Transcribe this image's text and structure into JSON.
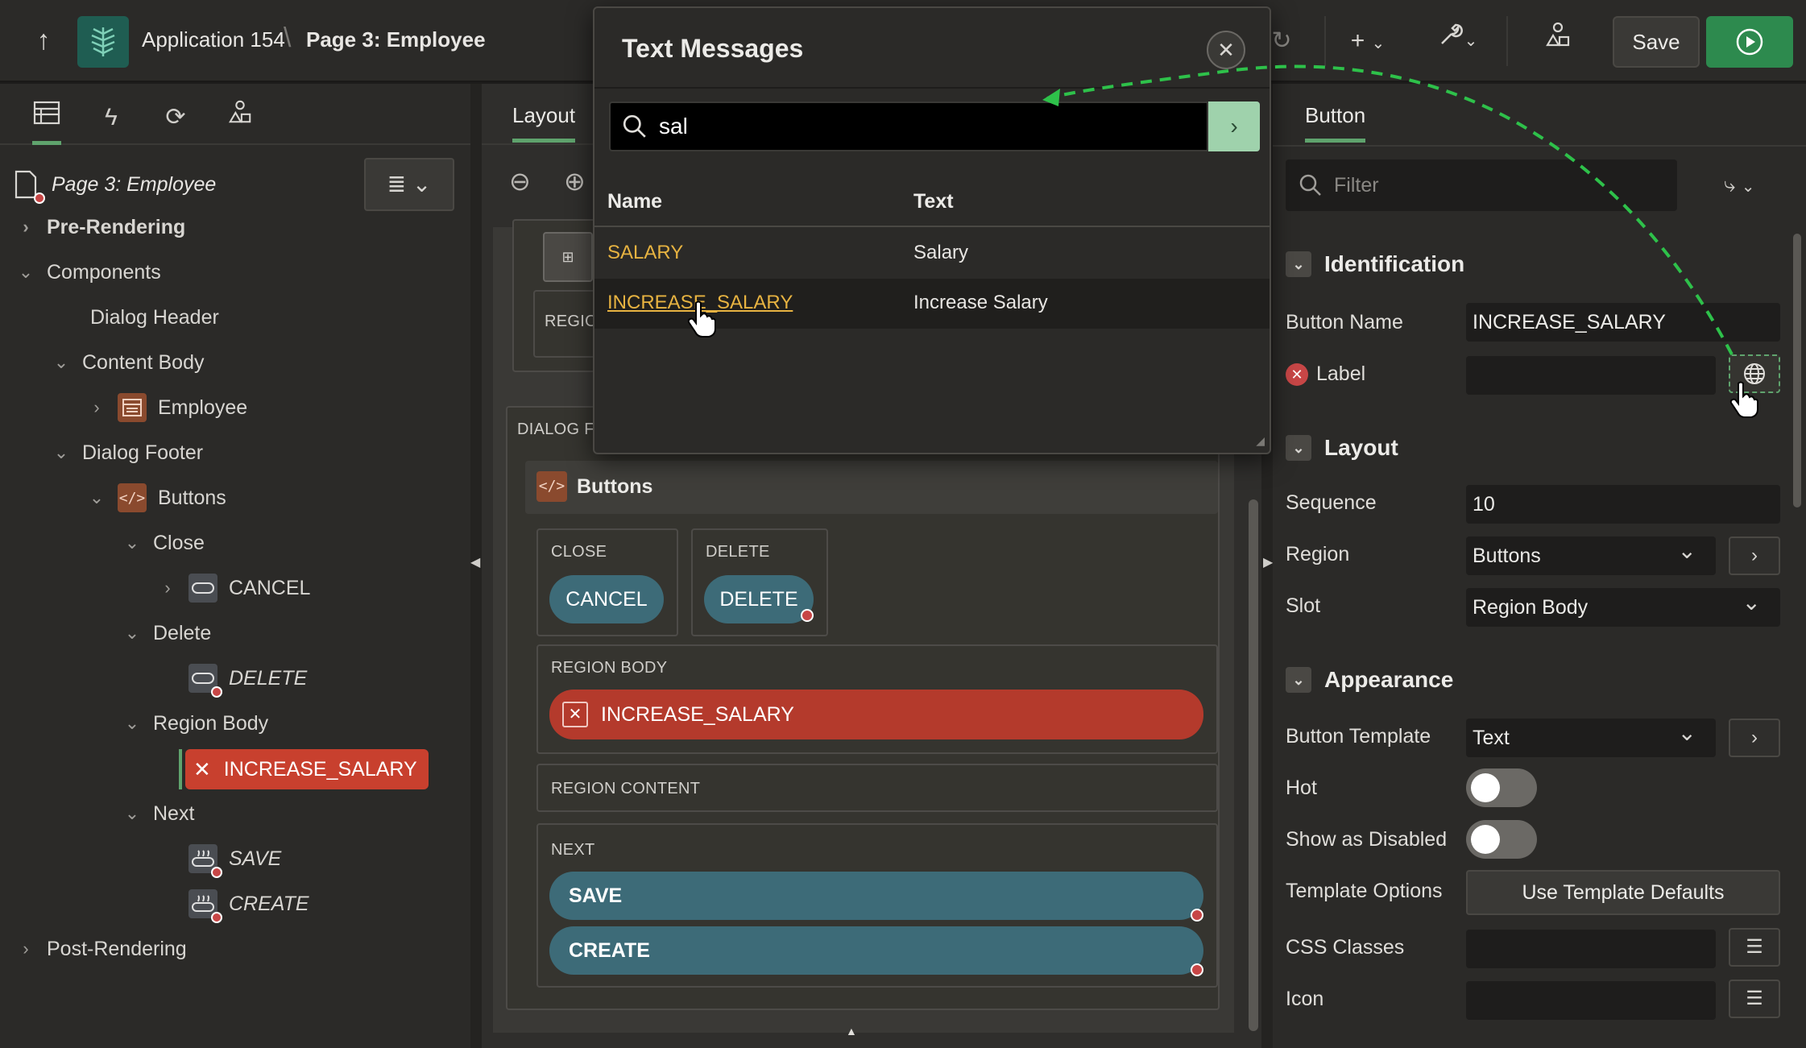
{
  "header": {
    "app_name": "Application 154",
    "separator": "\\",
    "page_name": "Page 3: Employee",
    "save_label": "Save"
  },
  "left_panel": {
    "page_title": "Page 3: Employee",
    "tree": {
      "pre_rendering": "Pre-Rendering",
      "components": "Components",
      "dialog_header": "Dialog Header",
      "content_body": "Content Body",
      "employee": "Employee",
      "dialog_footer": "Dialog Footer",
      "buttons": "Buttons",
      "close": "Close",
      "cancel": "CANCEL",
      "delete_slot": "Delete",
      "delete_btn": "DELETE",
      "region_body": "Region Body",
      "increase_salary": "INCREASE_SALARY",
      "next": "Next",
      "save": "SAVE",
      "create": "CREATE",
      "post_rendering": "Post-Rendering"
    }
  },
  "center": {
    "tab": "Layout",
    "region_label": "REGION",
    "dialog_footer_label": "DIALOG FO",
    "buttons_region": "Buttons",
    "close_label": "CLOSE",
    "delete_label": "DELETE",
    "cancel_btn": "CANCEL",
    "delete_btn": "DELETE",
    "region_body_label": "REGION BODY",
    "increase_salary": "INCREASE_SALARY",
    "region_content_label": "REGION CONTENT",
    "next_label": "NEXT",
    "save_btn": "SAVE",
    "create_btn": "CREATE"
  },
  "dialog": {
    "title": "Text Messages",
    "search_value": "sal",
    "col_name": "Name",
    "col_text": "Text",
    "rows": [
      {
        "name": "SALARY",
        "text": "Salary"
      },
      {
        "name": "INCREASE_SALARY",
        "text": "Increase Salary"
      }
    ]
  },
  "right_panel": {
    "tab": "Button",
    "filter_placeholder": "Filter",
    "identification": "Identification",
    "button_name_label": "Button Name",
    "button_name_value": "INCREASE_SALARY",
    "label_label": "Label",
    "label_value": "",
    "layout": "Layout",
    "sequence_label": "Sequence",
    "sequence_value": "10",
    "region_label": "Region",
    "region_value": "Buttons",
    "slot_label": "Slot",
    "slot_value": "Region Body",
    "appearance": "Appearance",
    "button_template_label": "Button Template",
    "button_template_value": "Text",
    "hot_label": "Hot",
    "hot_value": false,
    "show_disabled_label": "Show as Disabled",
    "show_disabled_value": false,
    "template_options_label": "Template Options",
    "template_options_btn": "Use Template Defaults",
    "css_classes_label": "CSS Classes",
    "icon_label": "Icon"
  },
  "colors": {
    "accent_green": "#5fa36d",
    "error_red": "#c8402e",
    "link_gold": "#e7b341",
    "button_teal": "#3d6b78"
  }
}
